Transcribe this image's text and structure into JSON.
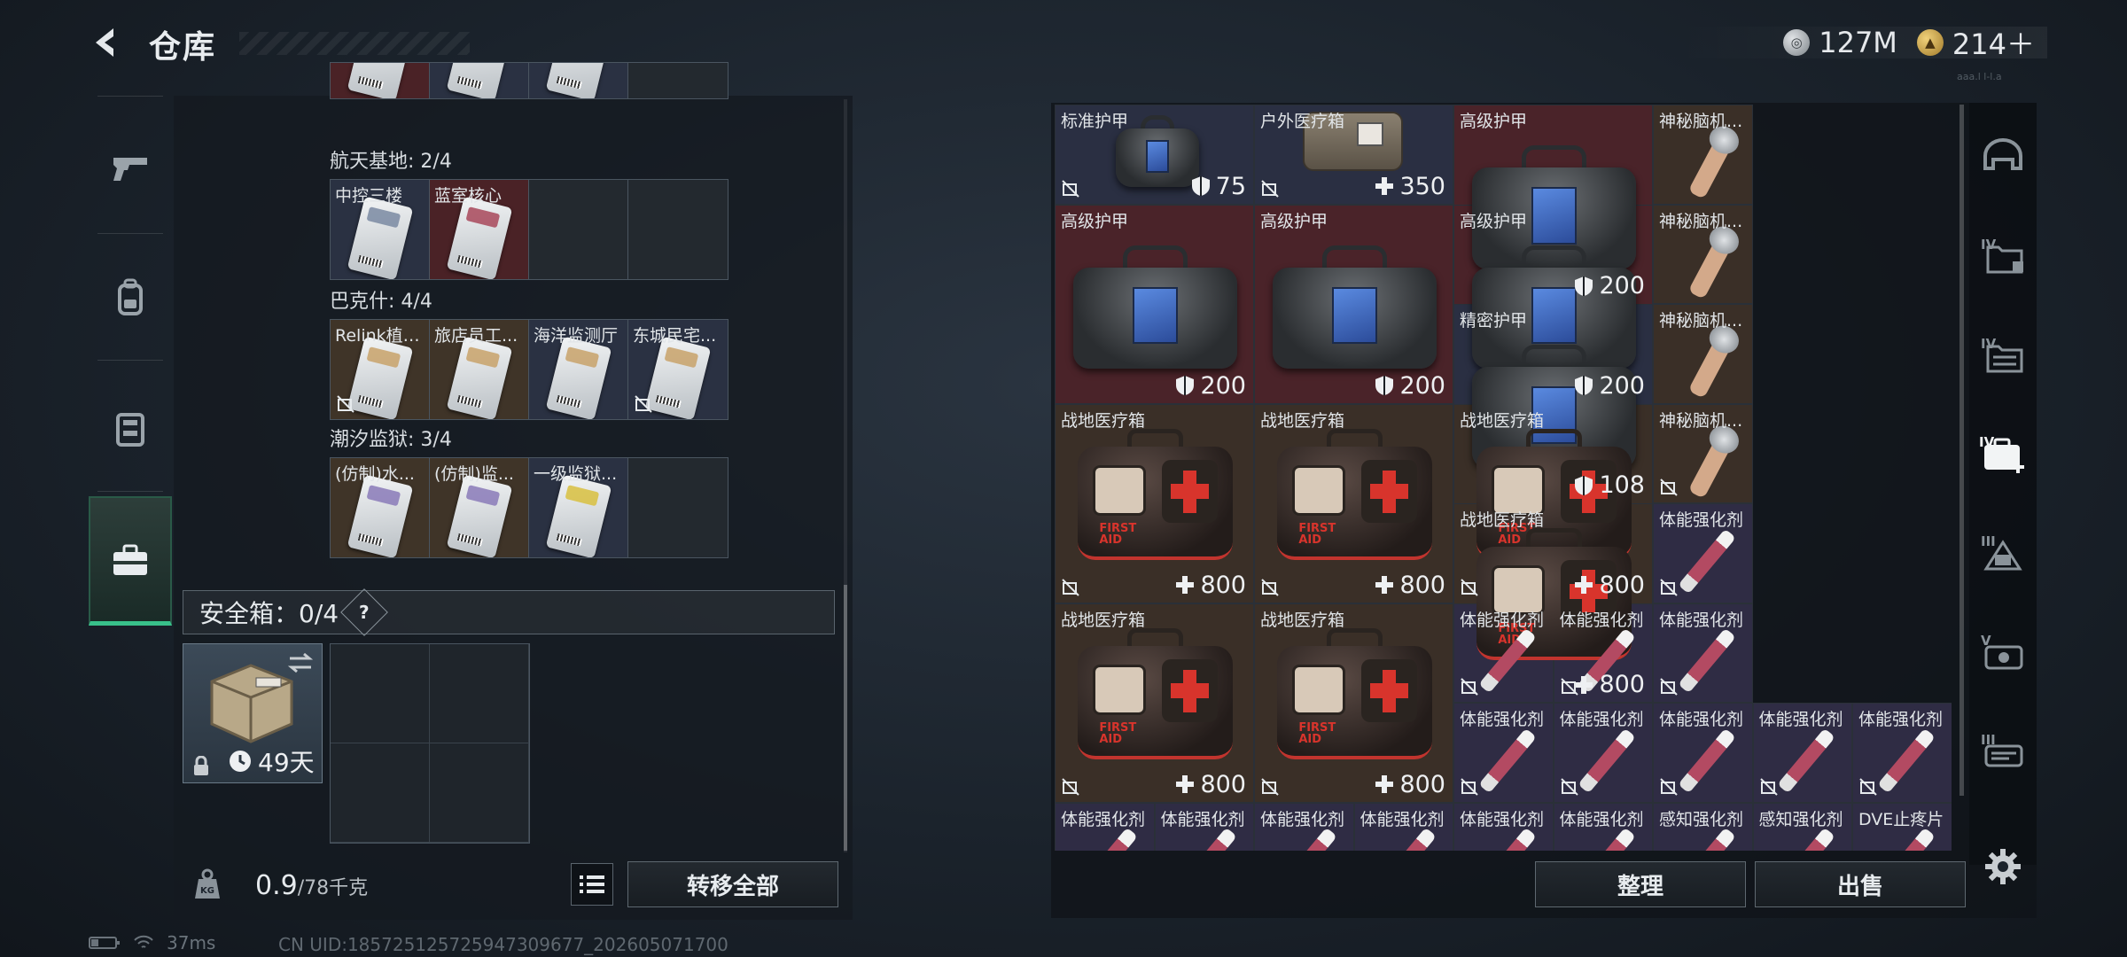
{
  "header": {
    "title": "仓库"
  },
  "currency": [
    {
      "icon": "silver-coin-icon",
      "value": "127M"
    },
    {
      "icon": "gold-coin-icon",
      "value": "214＋"
    }
  ],
  "server_code": "aaa.l l-l.a",
  "left_nav": [
    {
      "name": "weapon-tab",
      "icon": "pistol-icon",
      "active": false
    },
    {
      "name": "backpack-tab",
      "icon": "backpack-icon",
      "active": false
    },
    {
      "name": "vest-tab",
      "icon": "chest-rig-icon",
      "active": false
    },
    {
      "name": "case-tab",
      "icon": "briefcase-icon",
      "active": true
    }
  ],
  "key_groups": [
    {
      "label": "",
      "cells": [
        {
          "name": "",
          "bg": "red",
          "tint": "#b3374a"
        },
        {
          "name": "",
          "bg": "blue",
          "tint": "#6d8aa8"
        },
        {
          "name": "",
          "bg": "blue",
          "tint": "#6d8aa8"
        },
        {
          "name": "",
          "bg": "empty"
        }
      ]
    },
    {
      "label": "航天基地: 2/4",
      "cells": [
        {
          "name": "中控三楼",
          "bg": "blue",
          "tint": "#7a8aa2",
          "nosell": false
        },
        {
          "name": "蓝室核心",
          "bg": "red",
          "tint": "#a8485a",
          "nosell": false
        },
        {
          "name": "",
          "bg": "empty"
        },
        {
          "name": "",
          "bg": "empty"
        }
      ]
    },
    {
      "label": "巴克什: 4/4",
      "cells": [
        {
          "name": "Relink植入...",
          "bg": "brown",
          "tint": "#c8a26a",
          "nosell": true
        },
        {
          "name": "旅店员工...",
          "bg": "brown",
          "tint": "#c8a26a",
          "nosell": false
        },
        {
          "name": "海洋监测厅",
          "bg": "blue",
          "tint": "#c8a26a",
          "nosell": false
        },
        {
          "name": "东城民宅...",
          "bg": "blue",
          "tint": "#c8a26a",
          "nosell": true
        }
      ]
    },
    {
      "label": "潮汐监狱: 3/4",
      "cells": [
        {
          "name": "(仿制)水...",
          "bg": "brown",
          "tint": "#8a7ab8",
          "nosell": false
        },
        {
          "name": "(仿制)监...",
          "bg": "brown",
          "tint": "#8a7ab8",
          "nosell": false
        },
        {
          "name": "一级监狱...",
          "bg": "blue",
          "tint": "#d8c040",
          "nosell": false
        },
        {
          "name": "",
          "bg": "empty"
        }
      ]
    }
  ],
  "safe_box": {
    "title": "安全箱：0/4",
    "help": "?",
    "days": "49天"
  },
  "footer": {
    "weight_main": "0.9",
    "weight_sub": "/78千克",
    "transfer_all": "转移全部",
    "weight_icon": "kg-weight-icon"
  },
  "inventory": [
    {
      "name": "标准护甲",
      "kind": "bag",
      "col": 0,
      "row": 0,
      "w": 2,
      "h": 1,
      "bg": "blue",
      "value": "75",
      "value_icon": "shield",
      "nosell": true
    },
    {
      "name": "户外医疗箱",
      "kind": "kit350",
      "col": 2,
      "row": 0,
      "w": 2,
      "h": 1,
      "bg": "blue",
      "value": "350",
      "value_icon": "plus",
      "nosell": true
    },
    {
      "name": "高级护甲",
      "kind": "bag",
      "col": 4,
      "row": 0,
      "w": 2,
      "h": 2,
      "bg": "red",
      "value": "200",
      "value_icon": "shield",
      "nosell": false
    },
    {
      "name": "神秘脑机...",
      "kind": "cable",
      "col": 6,
      "row": 0,
      "w": 1,
      "h": 1,
      "bg": "brown",
      "value": "",
      "nosell": false
    },
    {
      "name": "高级护甲",
      "kind": "bag",
      "col": 0,
      "row": 1,
      "w": 2,
      "h": 2,
      "bg": "red",
      "value": "200",
      "value_icon": "shield",
      "nosell": false
    },
    {
      "name": "高级护甲",
      "kind": "bag",
      "col": 2,
      "row": 1,
      "w": 2,
      "h": 2,
      "bg": "red",
      "value": "200",
      "value_icon": "shield",
      "nosell": false
    },
    {
      "name": "高级护甲",
      "kind": "bag",
      "col": 4,
      "row": 1,
      "w": 2,
      "h": 2,
      "bg": "red",
      "value": "200",
      "value_icon": "shield",
      "nosell": false
    },
    {
      "name": "神秘脑机...",
      "kind": "cable",
      "col": 6,
      "row": 1,
      "w": 1,
      "h": 1,
      "bg": "brown",
      "value": "",
      "nosell": false
    },
    {
      "name": "精密护甲",
      "kind": "bag",
      "col": 4,
      "row": 2,
      "w": 2,
      "h": 2,
      "bg": "blue",
      "value": "108",
      "value_icon": "shield",
      "nosell": false
    },
    {
      "name": "神秘脑机...",
      "kind": "cable",
      "col": 6,
      "row": 2,
      "w": 1,
      "h": 1,
      "bg": "brown",
      "value": "",
      "nosell": false
    },
    {
      "name": "战地医疗箱",
      "kind": "medkit",
      "col": 0,
      "row": 3,
      "w": 2,
      "h": 2,
      "bg": "brown",
      "value": "800",
      "value_icon": "plus",
      "nosell": true
    },
    {
      "name": "战地医疗箱",
      "kind": "medkit",
      "col": 2,
      "row": 3,
      "w": 2,
      "h": 2,
      "bg": "brown",
      "value": "800",
      "value_icon": "plus",
      "nosell": true
    },
    {
      "name": "战地医疗箱",
      "kind": "medkit",
      "col": 4,
      "row": 3,
      "w": 2,
      "h": 2,
      "bg": "brown",
      "value": "800",
      "value_icon": "plus",
      "nosell": true
    },
    {
      "name": "神秘脑机...",
      "kind": "cable",
      "col": 6,
      "row": 3,
      "w": 1,
      "h": 1,
      "bg": "brown",
      "value": "",
      "nosell": true
    },
    {
      "name": "战地医疗箱",
      "kind": "medkit",
      "col": 4,
      "row": 4,
      "w": 2,
      "h": 2,
      "bg": "brown",
      "value": "800",
      "value_icon": "plus",
      "nosell": true
    },
    {
      "name": "体能强化剂",
      "kind": "inj",
      "col": 6,
      "row": 4,
      "w": 1,
      "h": 1,
      "bg": "purple",
      "value": "",
      "nosell": true
    },
    {
      "name": "战地医疗箱",
      "kind": "medkit",
      "col": 0,
      "row": 5,
      "w": 2,
      "h": 2,
      "bg": "brown",
      "value": "800",
      "value_icon": "plus",
      "nosell": true
    },
    {
      "name": "战地医疗箱",
      "kind": "medkit",
      "col": 2,
      "row": 5,
      "w": 2,
      "h": 2,
      "bg": "brown",
      "value": "800",
      "value_icon": "plus",
      "nosell": true
    },
    {
      "name": "体能强化剂",
      "kind": "inj",
      "col": 4,
      "row": 5,
      "w": 1,
      "h": 1,
      "bg": "purple",
      "value": "",
      "nosell": true
    },
    {
      "name": "体能强化剂",
      "kind": "inj",
      "col": 5,
      "row": 5,
      "w": 1,
      "h": 1,
      "bg": "purple",
      "value": "",
      "nosell": true
    },
    {
      "name": "体能强化剂",
      "kind": "inj",
      "col": 6,
      "row": 5,
      "w": 1,
      "h": 1,
      "bg": "purple",
      "value": "",
      "nosell": true
    },
    {
      "name": "体能强化剂",
      "kind": "inj",
      "col": 4,
      "row": 6,
      "w": 1,
      "h": 1,
      "bg": "purple",
      "value": "",
      "nosell": true
    },
    {
      "name": "体能强化剂",
      "kind": "inj",
      "col": 5,
      "row": 6,
      "w": 1,
      "h": 1,
      "bg": "purple",
      "value": "",
      "nosell": true
    },
    {
      "name": "体能强化剂",
      "kind": "inj",
      "col": 6,
      "row": 6,
      "w": 1,
      "h": 1,
      "bg": "purple",
      "value": "",
      "nosell": true
    },
    {
      "name": "体能强化剂",
      "kind": "inj",
      "col": 7,
      "row": 6,
      "w": 1,
      "h": 1,
      "bg": "purple",
      "value": "",
      "nosell": true
    },
    {
      "name": "体能强化剂",
      "kind": "inj",
      "col": 8,
      "row": 6,
      "w": 1,
      "h": 1,
      "bg": "purple",
      "value": "",
      "nosell": true
    },
    {
      "name": "体能强化剂",
      "kind": "inj",
      "col": 0,
      "row": 7,
      "w": 1,
      "h": 1,
      "bg": "purple",
      "value": "",
      "nosell": false
    },
    {
      "name": "体能强化剂",
      "kind": "inj",
      "col": 1,
      "row": 7,
      "w": 1,
      "h": 1,
      "bg": "purple",
      "value": "",
      "nosell": false
    },
    {
      "name": "体能强化剂",
      "kind": "inj",
      "col": 2,
      "row": 7,
      "w": 1,
      "h": 1,
      "bg": "purple",
      "value": "",
      "nosell": false
    },
    {
      "name": "体能强化剂",
      "kind": "inj",
      "col": 3,
      "row": 7,
      "w": 1,
      "h": 1,
      "bg": "purple",
      "value": "",
      "nosell": false
    },
    {
      "name": "体能强化剂",
      "kind": "inj",
      "col": 4,
      "row": 7,
      "w": 1,
      "h": 1,
      "bg": "purple",
      "value": "",
      "nosell": false
    },
    {
      "name": "体能强化剂",
      "kind": "inj",
      "col": 5,
      "row": 7,
      "w": 1,
      "h": 1,
      "bg": "purple",
      "value": "",
      "nosell": false
    },
    {
      "name": "感知强化剂",
      "kind": "inj",
      "col": 6,
      "row": 7,
      "w": 1,
      "h": 1,
      "bg": "purple",
      "value": "",
      "nosell": false
    },
    {
      "name": "感知强化剂",
      "kind": "inj",
      "col": 7,
      "row": 7,
      "w": 1,
      "h": 1,
      "bg": "purple",
      "value": "",
      "nosell": false
    },
    {
      "name": "DVE止疼片",
      "kind": "inj",
      "col": 8,
      "row": 7,
      "w": 1,
      "h": 1,
      "bg": "purple",
      "value": "",
      "nosell": false
    }
  ],
  "actions": {
    "sort": "整理",
    "sell": "出售"
  },
  "right_nav": [
    {
      "name": "helmet-filter",
      "icon": "helmet-icon"
    },
    {
      "name": "armor-iv-filter",
      "icon": "armor-folder-iv-icon",
      "tier": "IV"
    },
    {
      "name": "armor-iv-filter-2",
      "icon": "armor-folder-iv-icon",
      "tier": "IV"
    },
    {
      "name": "medkit-iv-filter",
      "icon": "medkit-iv-icon",
      "tier": "IV"
    },
    {
      "name": "tier-iii-filter",
      "icon": "tier-iii-icon",
      "tier": "III"
    },
    {
      "name": "tier-v-filter",
      "icon": "tier-v-icon",
      "tier": "V"
    },
    {
      "name": "tier-iii-filter-2",
      "icon": "tier-iii-case-icon",
      "tier": "III"
    }
  ],
  "status": {
    "ping": "37ms",
    "uid": "CN UID:1857251257259473096​77_202605071700"
  }
}
